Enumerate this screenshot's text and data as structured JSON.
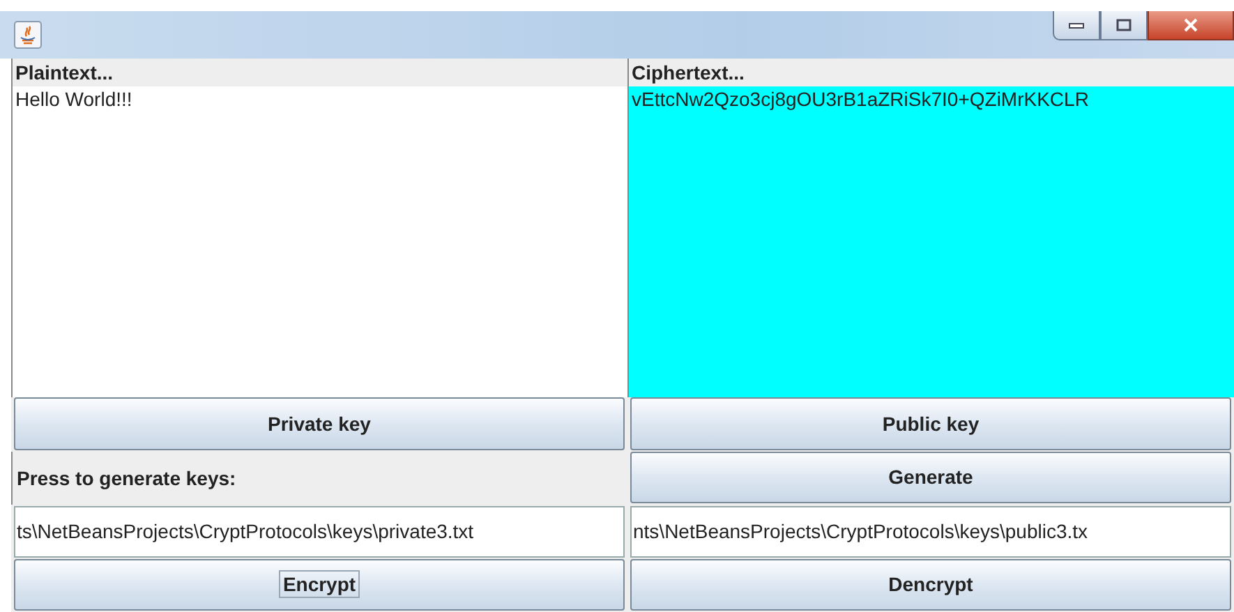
{
  "plaintext": {
    "label": "Plaintext...",
    "value": "Hello World!!!"
  },
  "ciphertext": {
    "label": "Ciphertext...",
    "value": "vEttcNw2Qzo3cj8gOU3rB1aZRiSk7I0+QZiMrKKCLR"
  },
  "rows": [
    {
      "items": [
        {
          "kind": "button",
          "label": "Private key",
          "focused": false
        },
        {
          "kind": "button",
          "label": "Public key",
          "focused": false
        }
      ]
    },
    {
      "items": [
        {
          "kind": "label",
          "label": "Press to generate keys:"
        },
        {
          "kind": "button",
          "label": "Generate",
          "focused": false
        }
      ]
    },
    {
      "items": [
        {
          "kind": "field",
          "value": "ts\\NetBeansProjects\\CryptProtocols\\keys\\private3.txt"
        },
        {
          "kind": "field",
          "value": "nts\\NetBeansProjects\\CryptProtocols\\keys\\public3.tx"
        }
      ]
    },
    {
      "items": [
        {
          "kind": "button",
          "label": "Encrypt",
          "focused": true
        },
        {
          "kind": "button",
          "label": "Dencrypt",
          "focused": false
        }
      ]
    }
  ]
}
